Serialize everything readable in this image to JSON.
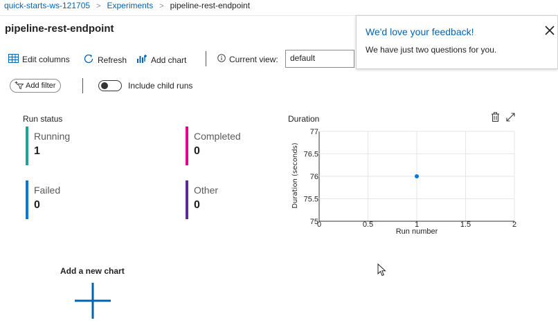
{
  "breadcrumb": {
    "workspace": "quick-starts-ws-121705",
    "experiments": "Experiments",
    "current": "pipeline-rest-endpoint"
  },
  "page_title": "pipeline-rest-endpoint",
  "toolbar": {
    "edit_columns": "Edit columns",
    "refresh": "Refresh",
    "add_chart": "Add chart",
    "current_view_label": "Current view:",
    "current_view_value": "default"
  },
  "filters": {
    "add_filter": "Add filter",
    "include_child_runs": "Include child runs"
  },
  "feedback": {
    "title": "We'd love your feedback!",
    "message": "We have just two questions for you."
  },
  "run_status": {
    "title": "Run status",
    "items": [
      {
        "label": "Running",
        "value": "1",
        "color": "#1aa39a"
      },
      {
        "label": "Completed",
        "value": "0",
        "color": "#e3008c"
      },
      {
        "label": "Failed",
        "value": "0",
        "color": "#0078d4"
      },
      {
        "label": "Other",
        "value": "0",
        "color": "#5c2d91"
      }
    ]
  },
  "chart_data": {
    "type": "scatter",
    "title": "Duration",
    "xlabel": "Run number",
    "ylabel": "Duration (seconds)",
    "xlim": [
      0,
      2
    ],
    "ylim": [
      75,
      77
    ],
    "x_ticks": [
      "0",
      "0.5",
      "1",
      "1.5",
      "2"
    ],
    "y_ticks": [
      "75",
      "75.5",
      "76",
      "76.5",
      "77"
    ],
    "points": [
      {
        "x": 1,
        "y": 76
      }
    ],
    "color": "#0078d4",
    "grid": true
  },
  "add_new_chart": "Add a new chart"
}
